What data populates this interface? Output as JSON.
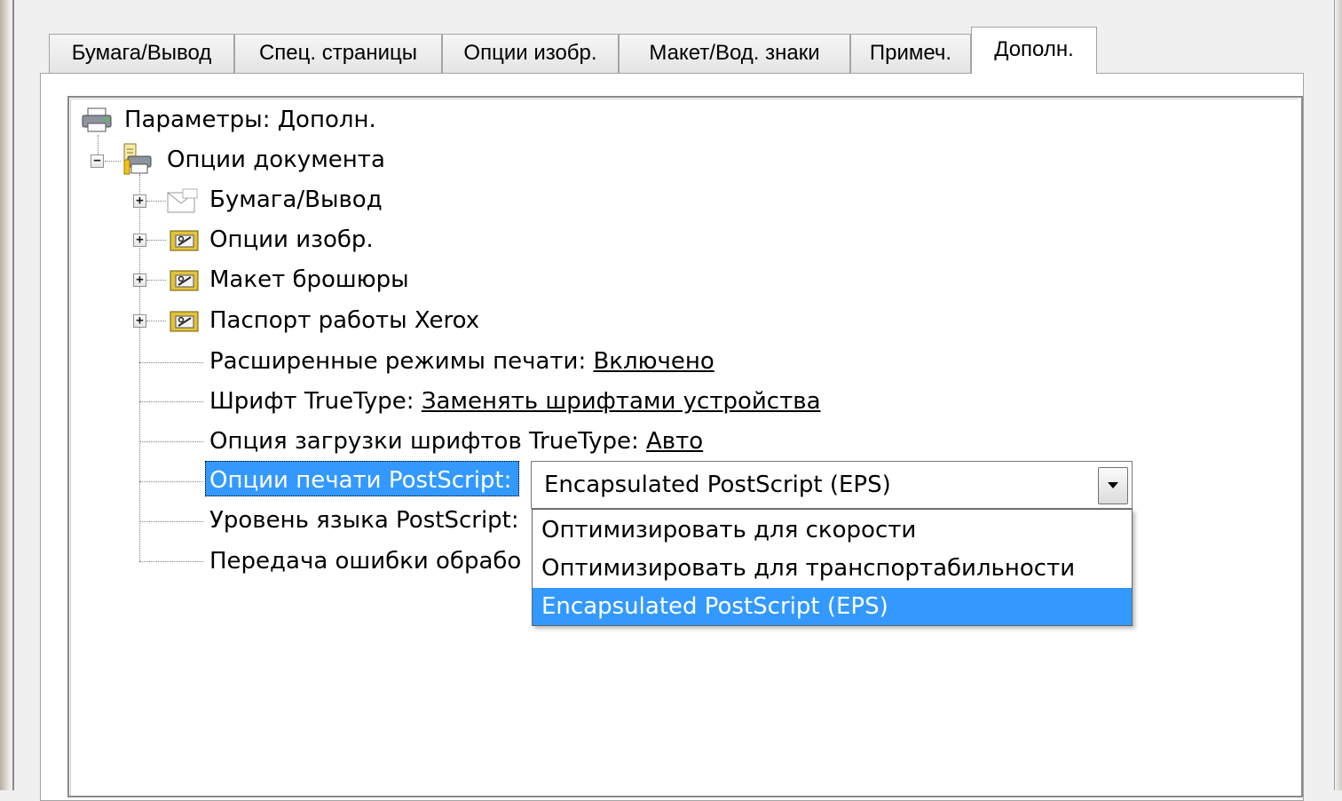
{
  "tabs": [
    {
      "label": "Бумага/Вывод"
    },
    {
      "label": "Спец. страницы"
    },
    {
      "label": "Опции изобр."
    },
    {
      "label": "Макет/Вод. знаки"
    },
    {
      "label": "Примеч."
    },
    {
      "label": "Дополн.",
      "active": true
    }
  ],
  "tree": {
    "root": "Параметры: Дополн.",
    "document_options": "Опции документа",
    "groups": [
      "Бумага/Вывод",
      "Опции изобр.",
      "Макет брошюры",
      "Паспорт работы Xerox"
    ],
    "settings": [
      {
        "label": "Расширенные режимы печати: ",
        "value": "Включено"
      },
      {
        "label": "Шрифт TrueType: ",
        "value": "Заменять шрифтами устройства"
      },
      {
        "label": "Опция загрузки шрифтов TrueType: ",
        "value": "Авто"
      },
      {
        "label": "Опции печати PostScript:",
        "value": ""
      },
      {
        "label": "Уровень языка PostScript: ",
        "value": ""
      },
      {
        "label": "Передача ошибки обрабо",
        "value": ""
      }
    ]
  },
  "combo": {
    "value": "Encapsulated PostScript (EPS)",
    "options": [
      "Оптимизировать для скорости",
      "Оптимизировать для транспортабильности",
      "Encapsulated PostScript (EPS)"
    ],
    "selected_index": 2
  },
  "colors": {
    "selection": "#3399ff"
  }
}
